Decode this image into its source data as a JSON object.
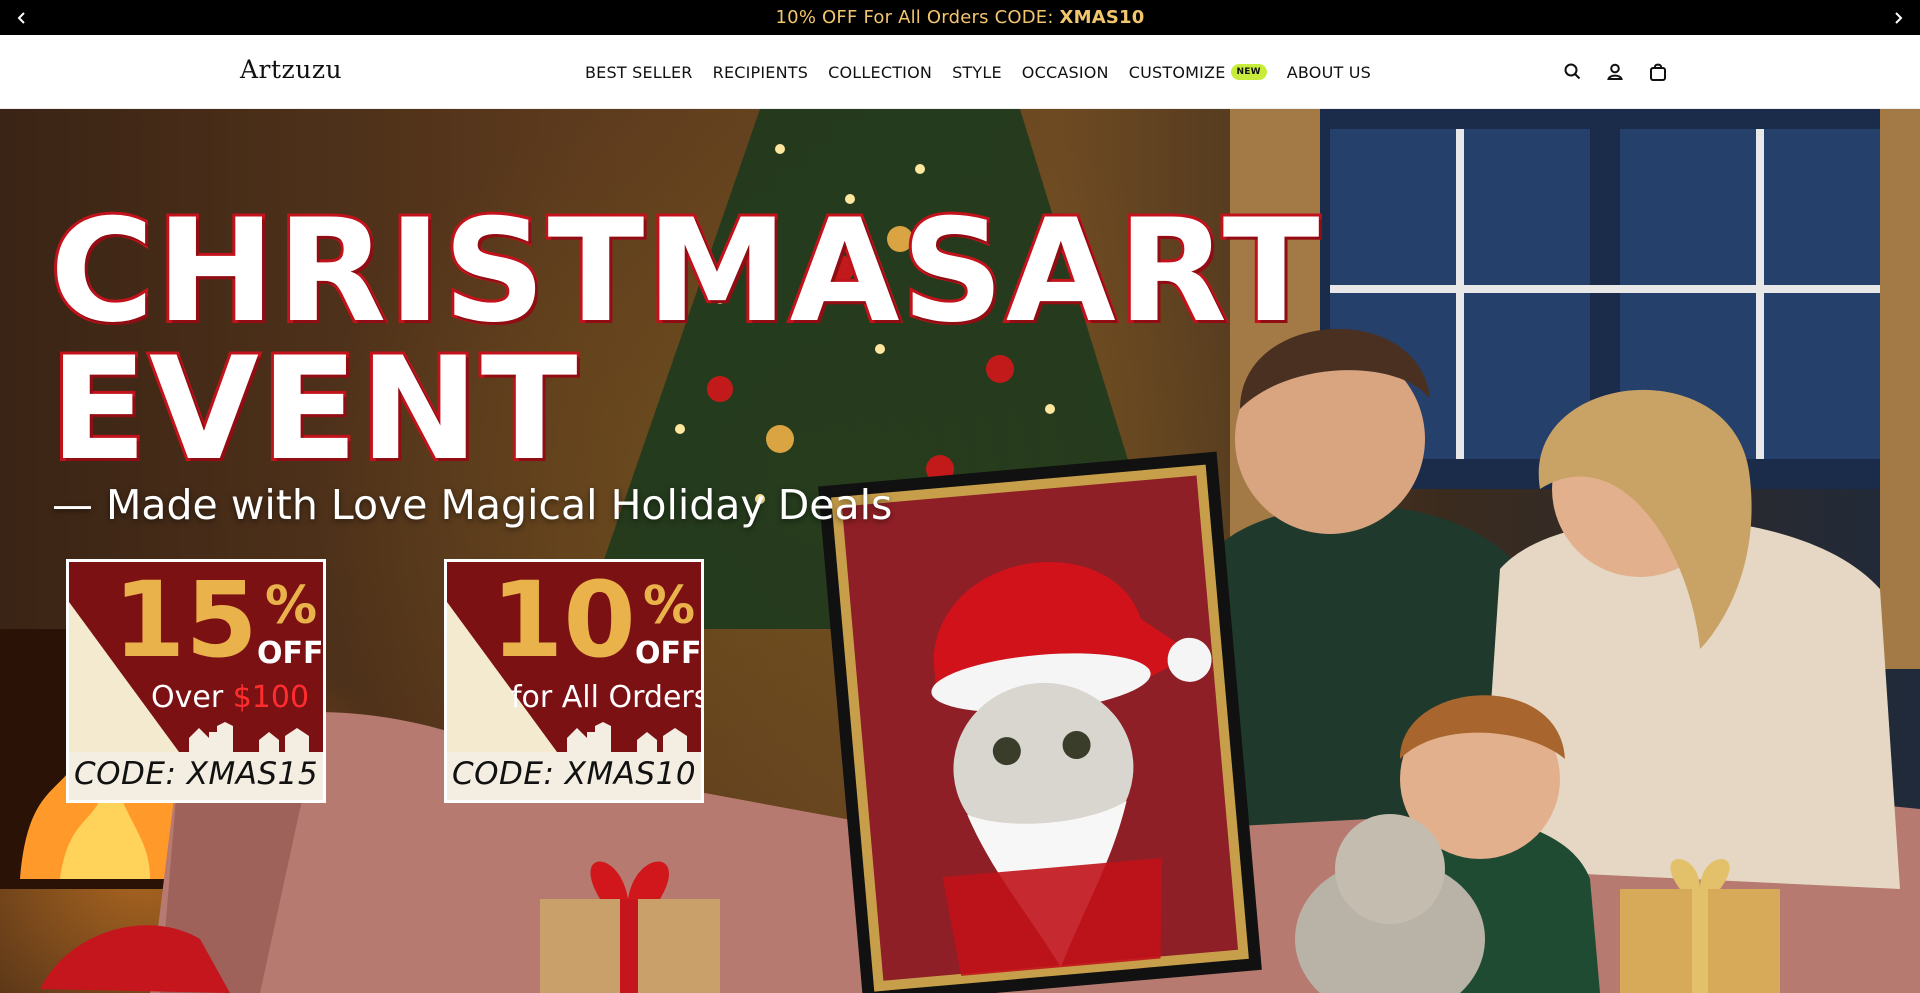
{
  "announcement": {
    "prefix": "10% OFF For All Orders CODE: ",
    "code": "XMAS10",
    "prev_icon": "chevron-left-icon",
    "next_icon": "chevron-right-icon"
  },
  "header": {
    "logo": "Artzuzu",
    "nav": [
      {
        "label": "BEST SELLER"
      },
      {
        "label": "RECIPIENTS"
      },
      {
        "label": "COLLECTION"
      },
      {
        "label": "STYLE"
      },
      {
        "label": "OCCASION"
      },
      {
        "label": "CUSTOMIZE",
        "badge": "NEW"
      },
      {
        "label": "ABOUT US"
      }
    ],
    "icons": [
      "search-icon",
      "account-icon",
      "cart-icon"
    ]
  },
  "hero": {
    "title_line1": "CHRISTMASART",
    "title_line2": "EVENT",
    "subtitle": "— Made with Love Magical Holiday Deals",
    "coupons": [
      {
        "percent": "15",
        "pct_symbol": "%",
        "off": "OFF",
        "line_prefix": "Over ",
        "line_highlight": "$100",
        "code": "CODE: XMAS15"
      },
      {
        "percent": "10",
        "pct_symbol": "%",
        "off": "OFF",
        "line_prefix": "for All Orders",
        "line_highlight": "",
        "code": "CODE:  XMAS10"
      }
    ]
  },
  "colors": {
    "announcement_bg": "#000000",
    "announcement_text": "#f2c66d",
    "badge_new": "#c8ec3b",
    "coupon_red": "#7c1114",
    "coupon_gold": "#e9b24a",
    "title_outline": "#c2121b"
  }
}
